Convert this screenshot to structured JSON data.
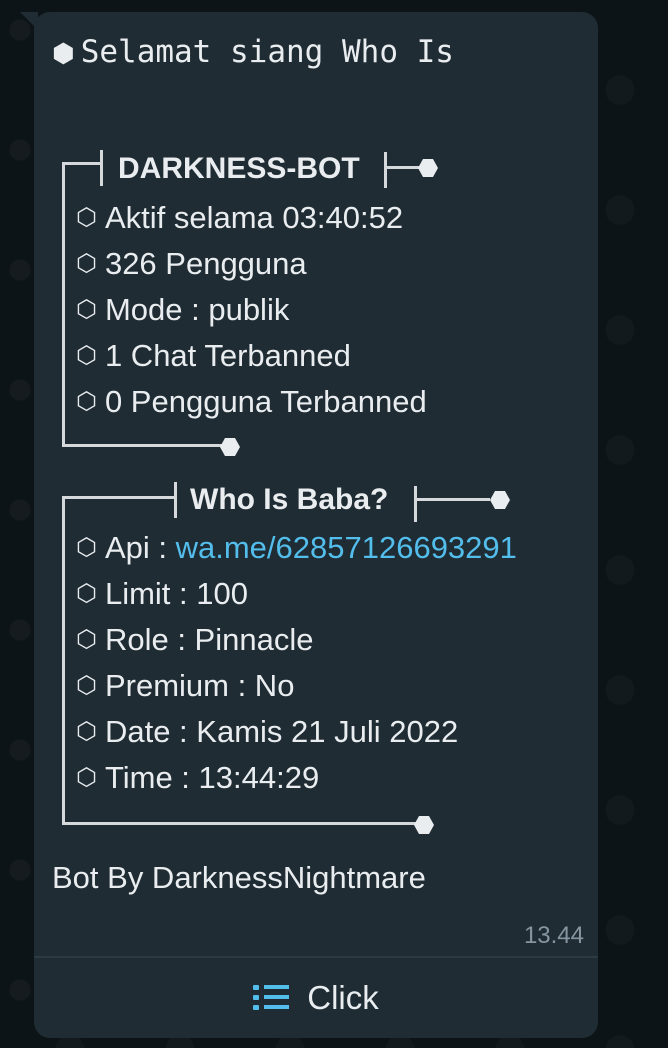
{
  "greeting": "Selamat siang Who Is",
  "status_card": {
    "title": "DARKNESS-BOT",
    "rows": [
      {
        "icon": "hexagon-outline-icon",
        "text": "Aktif selama 03:40:52"
      },
      {
        "icon": "hexagon-outline-icon",
        "text": "326 Pengguna"
      },
      {
        "icon": "hexagon-outline-icon",
        "text": "Mode : publik"
      },
      {
        "icon": "hexagon-outline-icon",
        "text": "1 Chat Terbanned"
      },
      {
        "icon": "hexagon-outline-icon",
        "text": "0 Pengguna Terbanned"
      }
    ]
  },
  "user_card": {
    "title": "Who Is Baba?",
    "api_label": "Api : ",
    "api_link": "wa.me/62857126693291",
    "rows": [
      {
        "icon": "hexagon-outline-icon",
        "text": "Limit : 100"
      },
      {
        "icon": "hexagon-outline-icon",
        "text": "Role : Pinnacle"
      },
      {
        "icon": "hexagon-outline-icon",
        "text": "Premium : No"
      },
      {
        "icon": "hexagon-outline-icon",
        "text": "Date : Kamis 21 Juli 2022"
      },
      {
        "icon": "hexagon-outline-icon",
        "text": "Time : 13:44:29"
      }
    ]
  },
  "footer": "Bot By DarknessNightmare",
  "timestamp": "13.44",
  "button": {
    "label": "Click",
    "icon": "list-icon"
  },
  "colors": {
    "background": "#0b141a",
    "bubble": "#1f2c34",
    "link": "#53bdeb",
    "timestamp": "#8696a0"
  }
}
